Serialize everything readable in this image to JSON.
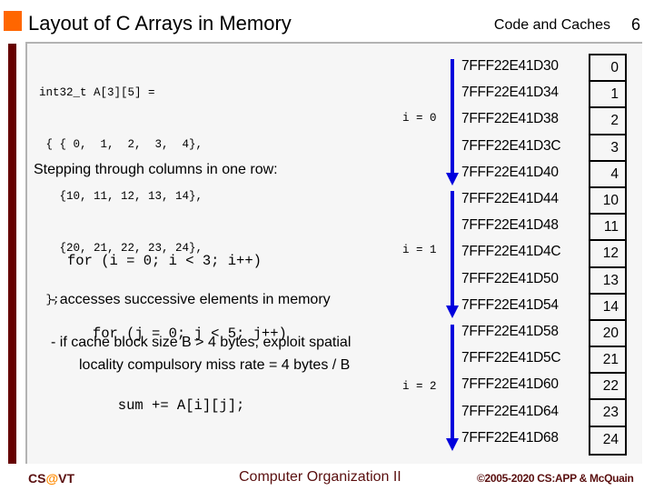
{
  "header": {
    "title": "Layout of C Arrays in Memory",
    "subtitle": "Code and Caches",
    "page_number": "6"
  },
  "code": {
    "declaration_lines": [
      "int32_t A[3][5] =",
      " { { 0,  1,  2,  3,  4},",
      "   {10, 11, 12, 13, 14},",
      "   {20, 21, 22, 23, 24},",
      " };"
    ],
    "loop_lines": [
      "for (i = 0; i < 3; i++)",
      "   for (j = 0; j < 5; j++)",
      "      sum += A[i][j];"
    ]
  },
  "body": {
    "heading": "Stepping through columns in one row:",
    "bullet1": "-  accesses successive elements in memory",
    "bullet2_line1": "-  if cache block size B > 4 bytes, exploit spatial",
    "bullet2_line2": "locality compulsory miss rate = 4 bytes / B"
  },
  "memory": {
    "row_labels": [
      "i = 0",
      "i = 1",
      "i = 2"
    ],
    "arrow_color": "#0000dd",
    "entries": [
      {
        "address": "7FFF22E41D30",
        "value": "0"
      },
      {
        "address": "7FFF22E41D34",
        "value": "1"
      },
      {
        "address": "7FFF22E41D38",
        "value": "2"
      },
      {
        "address": "7FFF22E41D3C",
        "value": "3"
      },
      {
        "address": "7FFF22E41D40",
        "value": "4"
      },
      {
        "address": "7FFF22E41D44",
        "value": "10"
      },
      {
        "address": "7FFF22E41D48",
        "value": "11"
      },
      {
        "address": "7FFF22E41D4C",
        "value": "12"
      },
      {
        "address": "7FFF22E41D50",
        "value": "13"
      },
      {
        "address": "7FFF22E41D54",
        "value": "14"
      },
      {
        "address": "7FFF22E41D58",
        "value": "20"
      },
      {
        "address": "7FFF22E41D5C",
        "value": "21"
      },
      {
        "address": "7FFF22E41D60",
        "value": "22"
      },
      {
        "address": "7FFF22E41D64",
        "value": "23"
      },
      {
        "address": "7FFF22E41D68",
        "value": "24"
      }
    ]
  },
  "footer": {
    "left_prefix": "CS",
    "left_at": "@",
    "left_suffix": "VT",
    "center": "Computer Organization II",
    "right": "©2005-2020 CS:APP & McQuain"
  },
  "colors": {
    "accent_orange": "#ff6600",
    "sidebar_maroon": "#660000",
    "footer_text": "#5a0f0f"
  }
}
